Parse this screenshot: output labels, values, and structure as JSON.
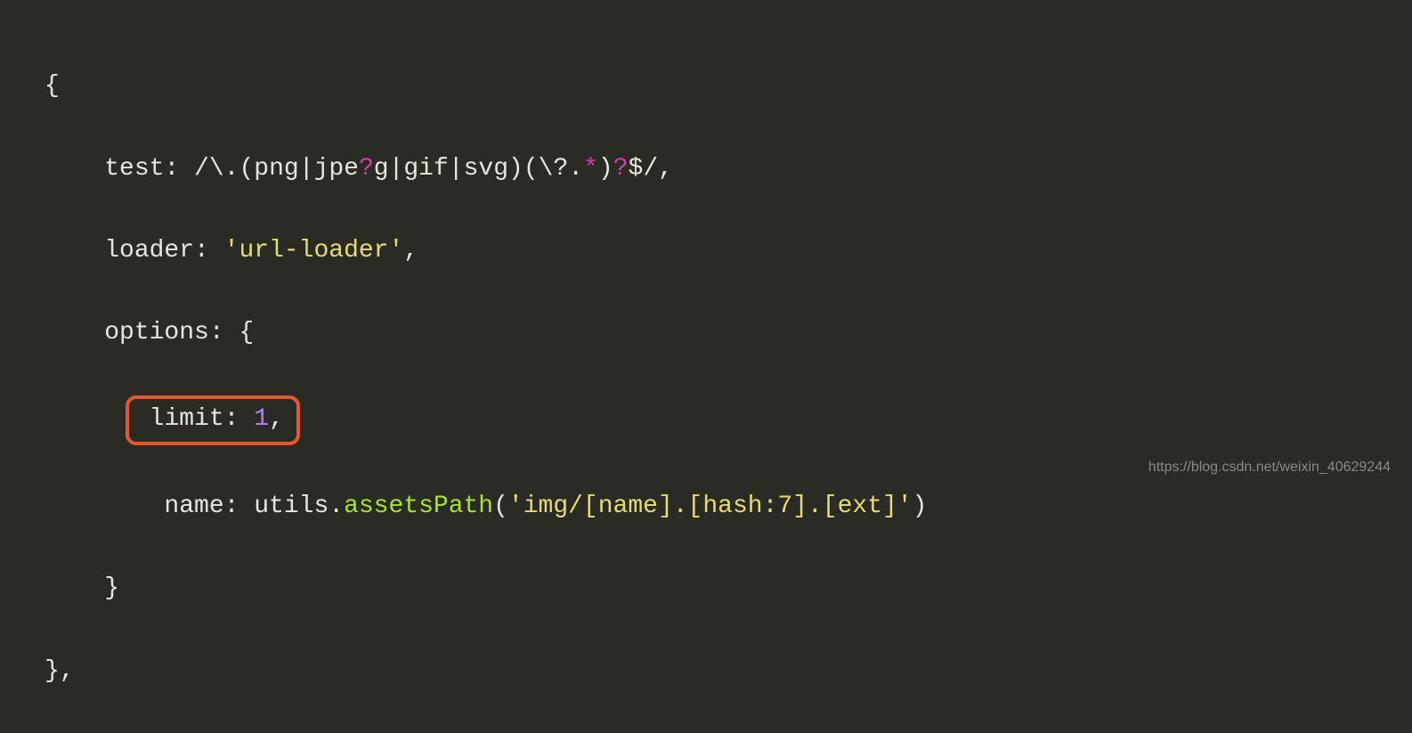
{
  "code": {
    "line1": "{",
    "line2_prop": "test",
    "line2_regex_open": "/",
    "line2_regex_escape": "\\.",
    "line2_regex_group1_open": "(",
    "line2_regex_png": "png",
    "line2_regex_pipe1": "|",
    "line2_regex_jpe": "jpe",
    "line2_regex_q1": "?",
    "line2_regex_g": "g",
    "line2_regex_pipe2": "|",
    "line2_regex_gif": "gif",
    "line2_regex_pipe3": "|",
    "line2_regex_svg": "svg",
    "line2_regex_group1_close": ")",
    "line2_regex_group2_open": "(",
    "line2_regex_escq": "\\?",
    "line2_regex_dot": ".",
    "line2_regex_star": "*",
    "line2_regex_group2_close": ")",
    "line2_regex_q2": "?",
    "line2_regex_anchor": "$",
    "line2_regex_close": "/",
    "line2_comma": ",",
    "line3_prop": "loader",
    "line3_string": "'url-loader'",
    "line3_comma": ",",
    "line4_prop": "options",
    "line4_brace": "{",
    "line5_prop": "limit",
    "line5_value": "1",
    "line5_comma": ",",
    "line6_prop": "name",
    "line6_var": "utils",
    "line6_dot": ".",
    "line6_method": "assetsPath",
    "line6_paren_open": "(",
    "line6_string": "'img/[name].[hash:7].[ext]'",
    "line6_paren_close": ")",
    "line7": "}",
    "line8_brace": "}",
    "line8_comma": ","
  },
  "watermark": "https://blog.csdn.net/weixin_40629244"
}
